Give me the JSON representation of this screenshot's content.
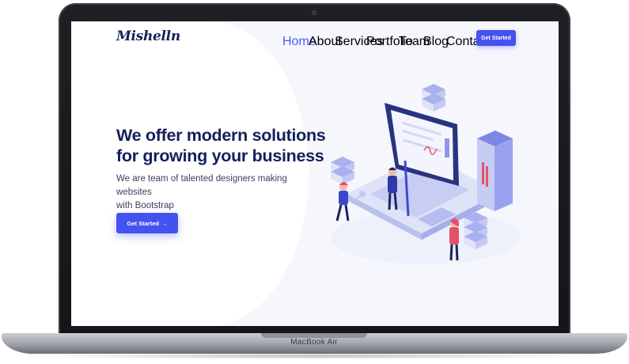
{
  "device": {
    "brand_label": "MacBook Air"
  },
  "site": {
    "logo": "Mishelln",
    "nav": {
      "items": [
        {
          "label": "Home",
          "active": true
        },
        {
          "label": "About",
          "active": false
        },
        {
          "label": "Services",
          "active": false
        },
        {
          "label": "Portfolio",
          "active": false
        },
        {
          "label": "Team",
          "active": false
        },
        {
          "label": "Blog",
          "active": false
        },
        {
          "label": "Contact",
          "active": false
        }
      ],
      "cta_label": "Get Started"
    },
    "hero": {
      "title_line1": "We offer modern solutions",
      "title_line2": "for growing your business",
      "subtitle_line1": "We are team of talented designers making websites",
      "subtitle_line2": "with Bootstrap",
      "cta_label": "Get Started",
      "cta_icon": "arrow-right-icon"
    },
    "colors": {
      "accent": "#4452f0",
      "heading": "#14205a",
      "background": "#f6f7fd"
    },
    "illustration": "isometric-team-website-illustration"
  }
}
